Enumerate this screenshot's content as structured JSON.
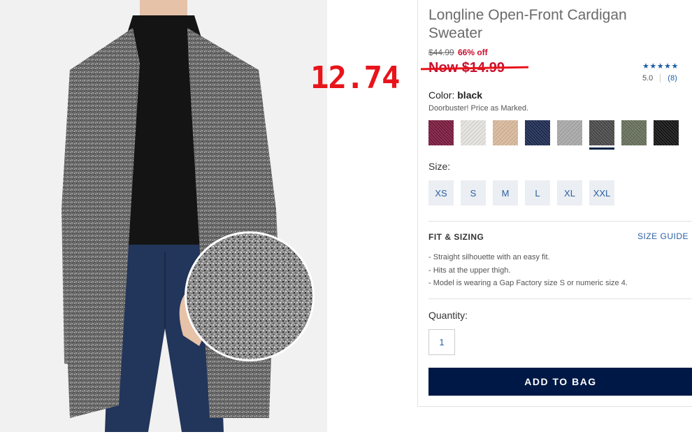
{
  "overlay": {
    "handwritten_price": "12.74"
  },
  "product": {
    "title": "Longline Open-Front Cardigan Sweater",
    "original_price": "$44.99",
    "discount": "66% off",
    "now_price": "Now $14.99",
    "rating": {
      "stars": "★★★★★",
      "value": "5.0",
      "count": "(8)"
    },
    "color_label": "Color:",
    "color_value": "black",
    "promo": "Doorbuster! Price as Marked.",
    "swatches": [
      {
        "name": "burgundy",
        "color": "#7a1a3e"
      },
      {
        "name": "light-gray",
        "color": "#e4e3df"
      },
      {
        "name": "oatmeal",
        "color": "#d9b99c"
      },
      {
        "name": "navy",
        "color": "#1e2b52"
      },
      {
        "name": "heather-gray",
        "color": "#a9a9a9"
      },
      {
        "name": "black-marled",
        "color": "#4a4a4a",
        "selected": true
      },
      {
        "name": "olive",
        "color": "#66705a"
      },
      {
        "name": "black",
        "color": "#151515"
      }
    ],
    "size_label": "Size:",
    "sizes": [
      "XS",
      "S",
      "M",
      "L",
      "XL",
      "XXL"
    ],
    "fit_heading": "FIT & SIZING",
    "size_guide": "SIZE GUIDE",
    "fit_notes": [
      "Straight silhouette with an easy fit.",
      "Hits at the upper thigh.",
      "Model is wearing a Gap Factory size S or numeric size 4."
    ],
    "quantity_label": "Quantity:",
    "quantity": "1",
    "add_to_bag": "ADD TO BAG"
  },
  "colors": {
    "accent": "#001845",
    "sale": "#c8102e",
    "link": "#2b5fa3",
    "annotation": "#e8141b"
  }
}
